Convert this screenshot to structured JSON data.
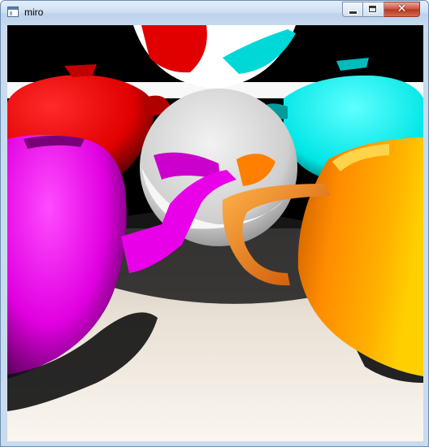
{
  "window": {
    "title": "miro",
    "controls": {
      "minimize_icon": "minimize-icon",
      "maximize_icon": "maximize-icon",
      "close_glyph": "✕"
    }
  },
  "scene": {
    "description_icon": "raytraced-teapots",
    "colors": {
      "red": "#ff0000",
      "cyan": "#00ffff",
      "magenta": "#ff00ff",
      "orange": "#ff8c00",
      "yellow": "#ffd700",
      "sphere": "#d8d8d8",
      "floor": "#f4ede4"
    }
  }
}
